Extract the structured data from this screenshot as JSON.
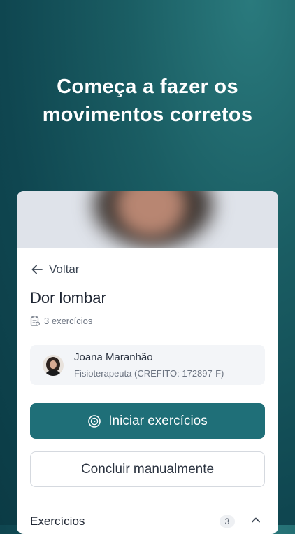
{
  "promo": {
    "headline_line1": "Começa a fazer os",
    "headline_line2": "movimentos corretos"
  },
  "nav": {
    "back_label": "Voltar",
    "back_icon": "arrow-left-icon"
  },
  "plan": {
    "title": "Dor lombar",
    "exercise_count_label": "3 exercícios",
    "exercise_count_icon": "clipboard-icon"
  },
  "therapist": {
    "name": "Joana Maranhão",
    "role": "Fisioterapeuta (CREFITO: 172897-F)"
  },
  "actions": {
    "start_label": "Iniciar exercícios",
    "start_icon": "play-circle-icon",
    "complete_label": "Concluir manualmente"
  },
  "exercises_section": {
    "title": "Exercícios",
    "count": "3",
    "toggle_icon": "chevron-up-icon"
  },
  "colors": {
    "primary": "#1f6f78",
    "background_dark": "#0b3b45",
    "background_light": "#2a7a7d"
  }
}
